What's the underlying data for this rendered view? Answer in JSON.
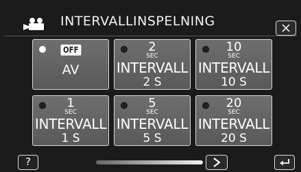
{
  "header": {
    "title": "INTERVALLINSPELNING",
    "mode_icon": "video-camera-icon",
    "close_icon": "close-x-icon"
  },
  "options": [
    {
      "label": "AV",
      "badge": "OFF",
      "selected": true
    },
    {
      "num": "2",
      "unit": "SEC",
      "label": "INTERVALL",
      "value": "2 S",
      "selected": false
    },
    {
      "num": "10",
      "unit": "SEC",
      "label": "INTERVALL",
      "value": "10 S",
      "selected": false
    },
    {
      "num": "1",
      "unit": "SEC",
      "label": "INTERVALL",
      "value": "1 S",
      "selected": false
    },
    {
      "num": "5",
      "unit": "SEC",
      "label": "INTERVALL",
      "value": "5 S",
      "selected": false
    },
    {
      "num": "20",
      "unit": "SEC",
      "label": "INTERVALL",
      "value": "20 S",
      "selected": false
    }
  ],
  "footer": {
    "help_label": "?",
    "next_icon": "chevron-right-icon",
    "back_icon": "return-arrow-icon"
  },
  "colors": {
    "background": "#1b1b1b",
    "tile": "#646464",
    "tile_border": "#d9d9d9",
    "text": "#ffffff"
  }
}
